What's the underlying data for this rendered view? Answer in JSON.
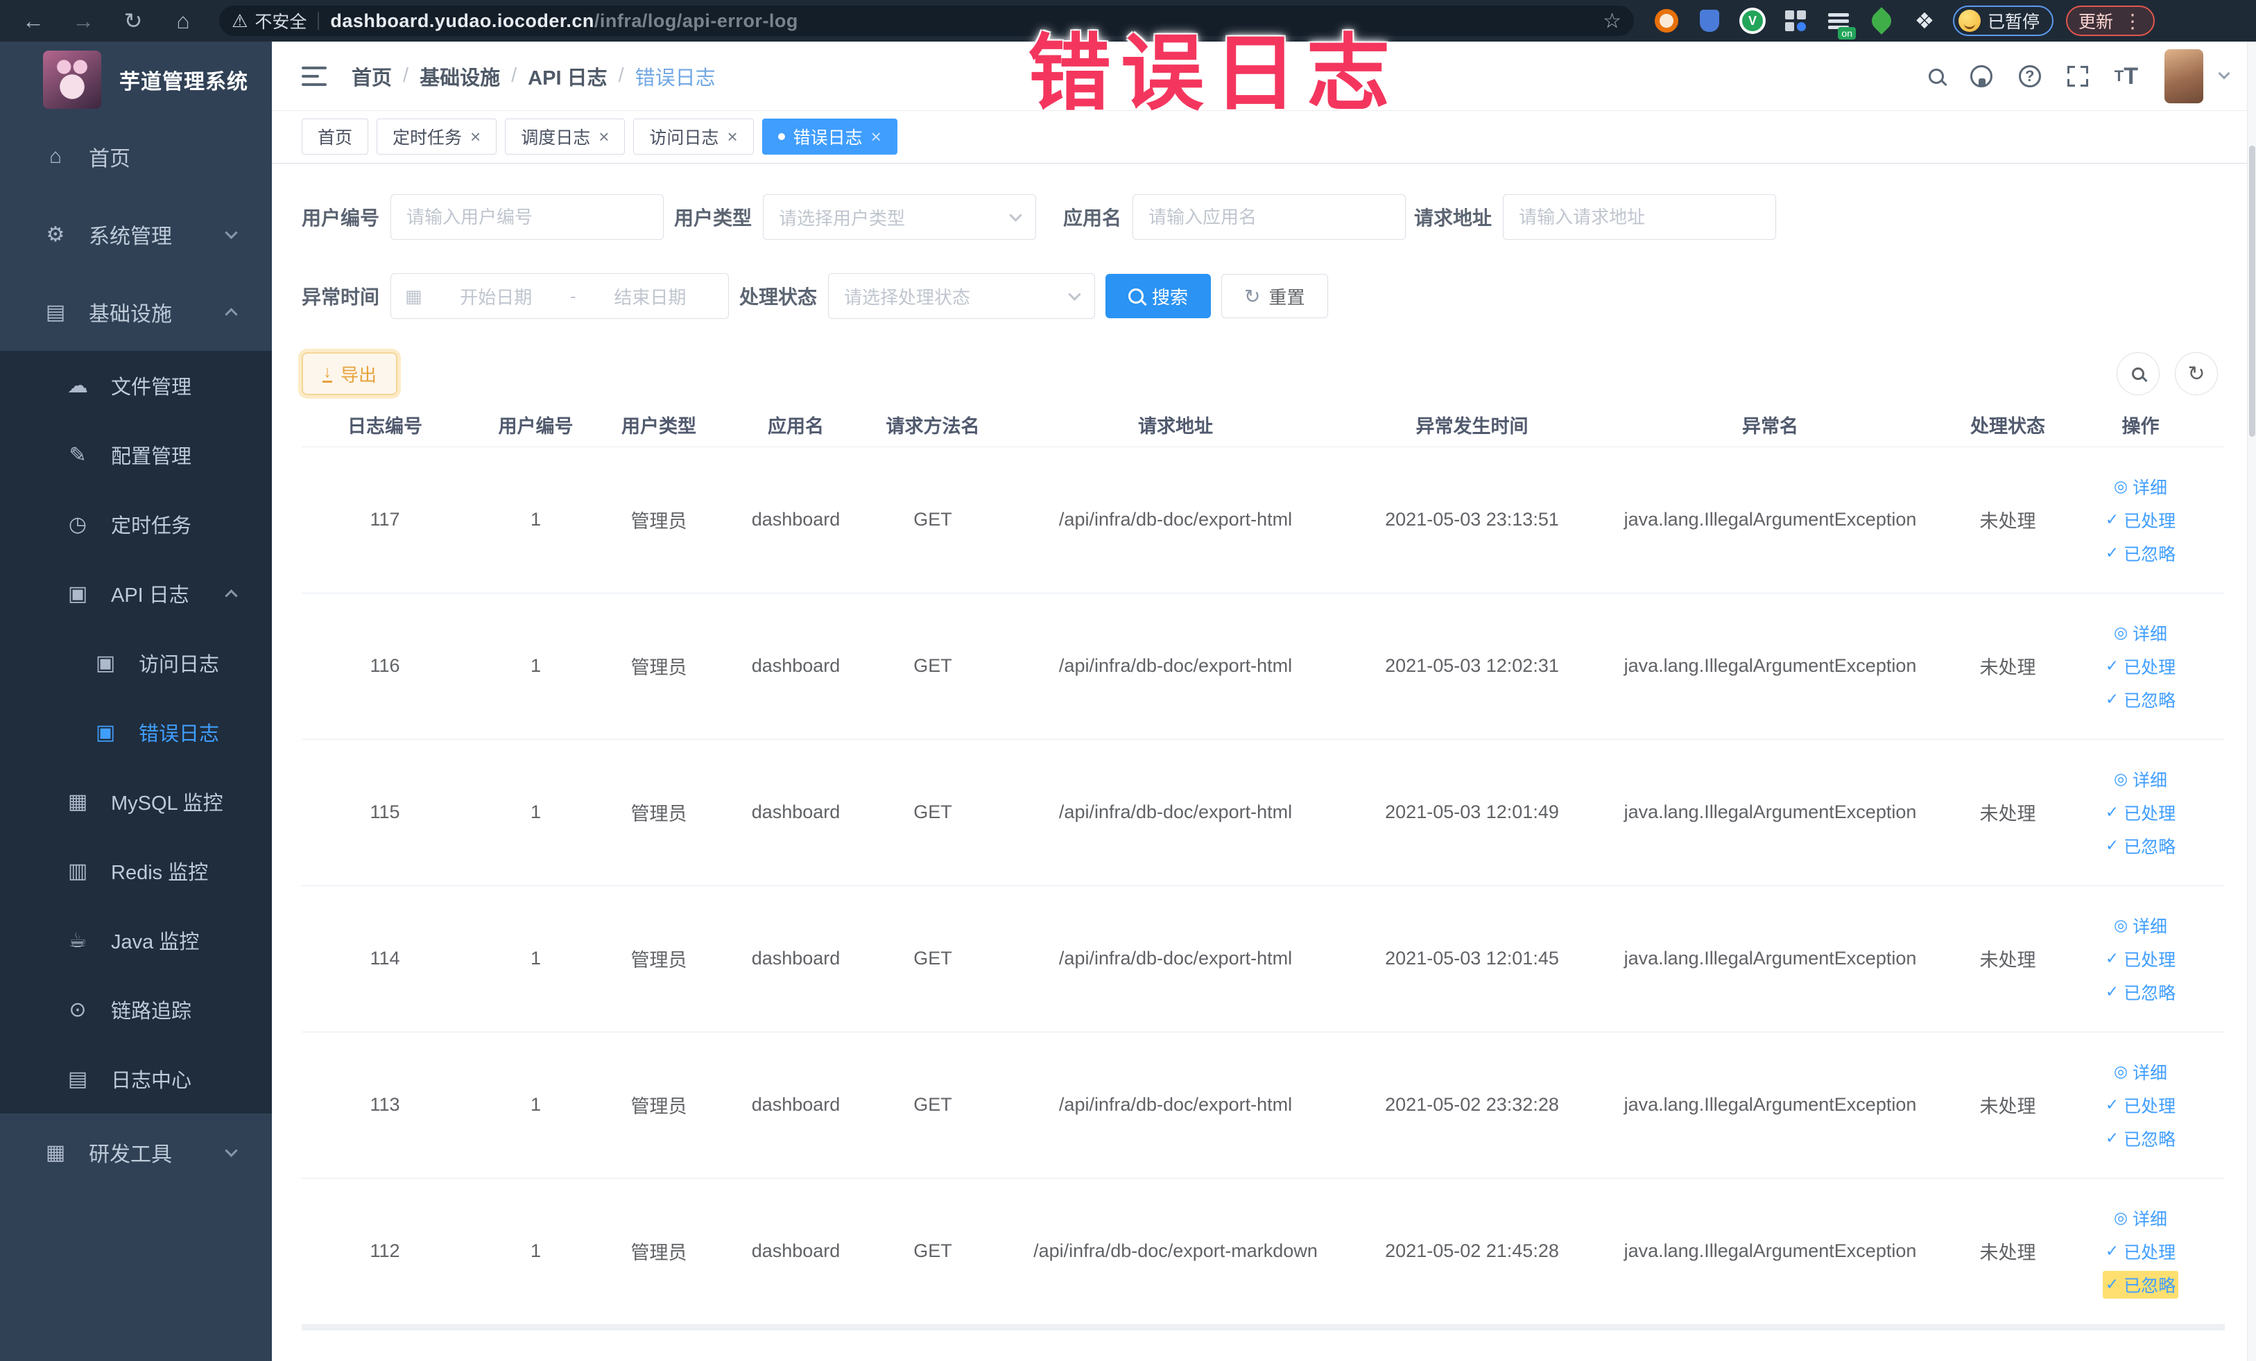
{
  "browser": {
    "security_label": "不安全",
    "url_domain": "dashboard.yudao.iocoder.cn",
    "url_path": "/infra/log/api-error-log",
    "paused_label": "已暂停",
    "update_label": "更新"
  },
  "overlay": {
    "text": "错误日志",
    "color": "#f4365e"
  },
  "icons": {
    "back": "←",
    "forward": "→",
    "reload": "↻",
    "home": "⌂",
    "warning": "⚠",
    "star": "☆",
    "kebab": "⋮",
    "puzzle": "❖",
    "calendar": "▦",
    "download": "↓",
    "refresh": "↻",
    "eye": "◎",
    "check": "✓",
    "home-icon": "⌂",
    "gear-icon": "⚙",
    "infrastructure-icon": "▤",
    "file-manage-icon": "☁",
    "config-manage-icon": "✎",
    "scheduled-job-icon": "◷",
    "api-log-icon": "▣",
    "access-log-icon": "▣",
    "error-log-icon": "▣",
    "mysql-monitor-icon": "▦",
    "redis-monitor-icon": "▥",
    "java-monitor-icon": "☕",
    "trace-icon": "⊙",
    "log-center-icon": "▤",
    "dev-tools-icon": "▦"
  },
  "sidebar": {
    "title": "芋道管理系统",
    "menu": [
      {
        "label": "首页",
        "icon": "home-icon",
        "level": 1
      },
      {
        "label": "系统管理",
        "icon": "gear-icon",
        "level": 1,
        "chevron": "down"
      },
      {
        "label": "基础设施",
        "icon": "infrastructure-icon",
        "level": 1,
        "chevron": "up"
      },
      {
        "label": "文件管理",
        "icon": "file-manage-icon",
        "level": 2
      },
      {
        "label": "配置管理",
        "icon": "config-manage-icon",
        "level": 2
      },
      {
        "label": "定时任务",
        "icon": "scheduled-job-icon",
        "level": 2
      },
      {
        "label": "API 日志",
        "icon": "api-log-icon",
        "level": 2,
        "chevron": "up"
      },
      {
        "label": "访问日志",
        "icon": "access-log-icon",
        "level": 3
      },
      {
        "label": "错误日志",
        "icon": "error-log-icon",
        "level": 3,
        "active": true
      },
      {
        "label": "MySQL 监控",
        "icon": "mysql-monitor-icon",
        "level": 2
      },
      {
        "label": "Redis 监控",
        "icon": "redis-monitor-icon",
        "level": 2
      },
      {
        "label": "Java 监控",
        "icon": "java-monitor-icon",
        "level": 2
      },
      {
        "label": "链路追踪",
        "icon": "trace-icon",
        "level": 2
      },
      {
        "label": "日志中心",
        "icon": "log-center-icon",
        "level": 2
      },
      {
        "label": "研发工具",
        "icon": "dev-tools-icon",
        "level": 1,
        "chevron": "down"
      }
    ]
  },
  "header": {
    "breadcrumbs": [
      "首页",
      "基础设施",
      "API 日志",
      "错误日志"
    ]
  },
  "tabs": [
    {
      "label": "首页"
    },
    {
      "label": "定时任务",
      "closable": true
    },
    {
      "label": "调度日志",
      "closable": true
    },
    {
      "label": "访问日志",
      "closable": true
    },
    {
      "label": "错误日志",
      "closable": true,
      "active": true
    }
  ],
  "filters": {
    "user_id": {
      "label": "用户编号",
      "placeholder": "请输入用户编号"
    },
    "user_type": {
      "label": "用户类型",
      "placeholder": "请选择用户类型"
    },
    "app_name": {
      "label": "应用名",
      "placeholder": "请输入应用名"
    },
    "request_url": {
      "label": "请求地址",
      "placeholder": "请输入请求地址"
    },
    "exception_time": {
      "label": "异常时间",
      "start_placeholder": "开始日期",
      "separator": "-",
      "end_placeholder": "结束日期"
    },
    "process_status": {
      "label": "处理状态",
      "placeholder": "请选择处理状态"
    },
    "search_label": "搜索",
    "reset_label": "重置"
  },
  "toolbar": {
    "export_label": "导出"
  },
  "table": {
    "headers": [
      "日志编号",
      "用户编号",
      "用户类型",
      "应用名",
      "请求方法名",
      "请求地址",
      "异常发生时间",
      "异常名",
      "处理状态",
      "操作"
    ],
    "action_labels": [
      "详细",
      "已处理",
      "已忽略"
    ],
    "rows": [
      {
        "id": "117",
        "user_id": "1",
        "user_type": "管理员",
        "app": "dashboard",
        "method": "GET",
        "url": "/api/infra/db-doc/export-html",
        "time": "2021-05-03 23:13:51",
        "exception": "java.lang.IllegalArgumentException",
        "status": "未处理"
      },
      {
        "id": "116",
        "user_id": "1",
        "user_type": "管理员",
        "app": "dashboard",
        "method": "GET",
        "url": "/api/infra/db-doc/export-html",
        "time": "2021-05-03 12:02:31",
        "exception": "java.lang.IllegalArgumentException",
        "status": "未处理"
      },
      {
        "id": "115",
        "user_id": "1",
        "user_type": "管理员",
        "app": "dashboard",
        "method": "GET",
        "url": "/api/infra/db-doc/export-html",
        "time": "2021-05-03 12:01:49",
        "exception": "java.lang.IllegalArgumentException",
        "status": "未处理"
      },
      {
        "id": "114",
        "user_id": "1",
        "user_type": "管理员",
        "app": "dashboard",
        "method": "GET",
        "url": "/api/infra/db-doc/export-html",
        "time": "2021-05-03 12:01:45",
        "exception": "java.lang.IllegalArgumentException",
        "status": "未处理"
      },
      {
        "id": "113",
        "user_id": "1",
        "user_type": "管理员",
        "app": "dashboard",
        "method": "GET",
        "url": "/api/infra/db-doc/export-html",
        "time": "2021-05-02 23:32:28",
        "exception": "java.lang.IllegalArgumentException",
        "status": "未处理"
      },
      {
        "id": "112",
        "user_id": "1",
        "user_type": "管理员",
        "app": "dashboard",
        "method": "GET",
        "url": "/api/infra/db-doc/export-markdown",
        "time": "2021-05-02 21:45:28",
        "exception": "java.lang.IllegalArgumentException",
        "status": "未处理",
        "highlight_action": 2
      }
    ]
  },
  "colors": {
    "primary": "#409eff",
    "sidebar_bg": "#304156",
    "submenu_bg": "#1f2d3d",
    "active_tab": "#409eff",
    "warning": "#e6a23c",
    "overlay_red": "#f4365e"
  }
}
